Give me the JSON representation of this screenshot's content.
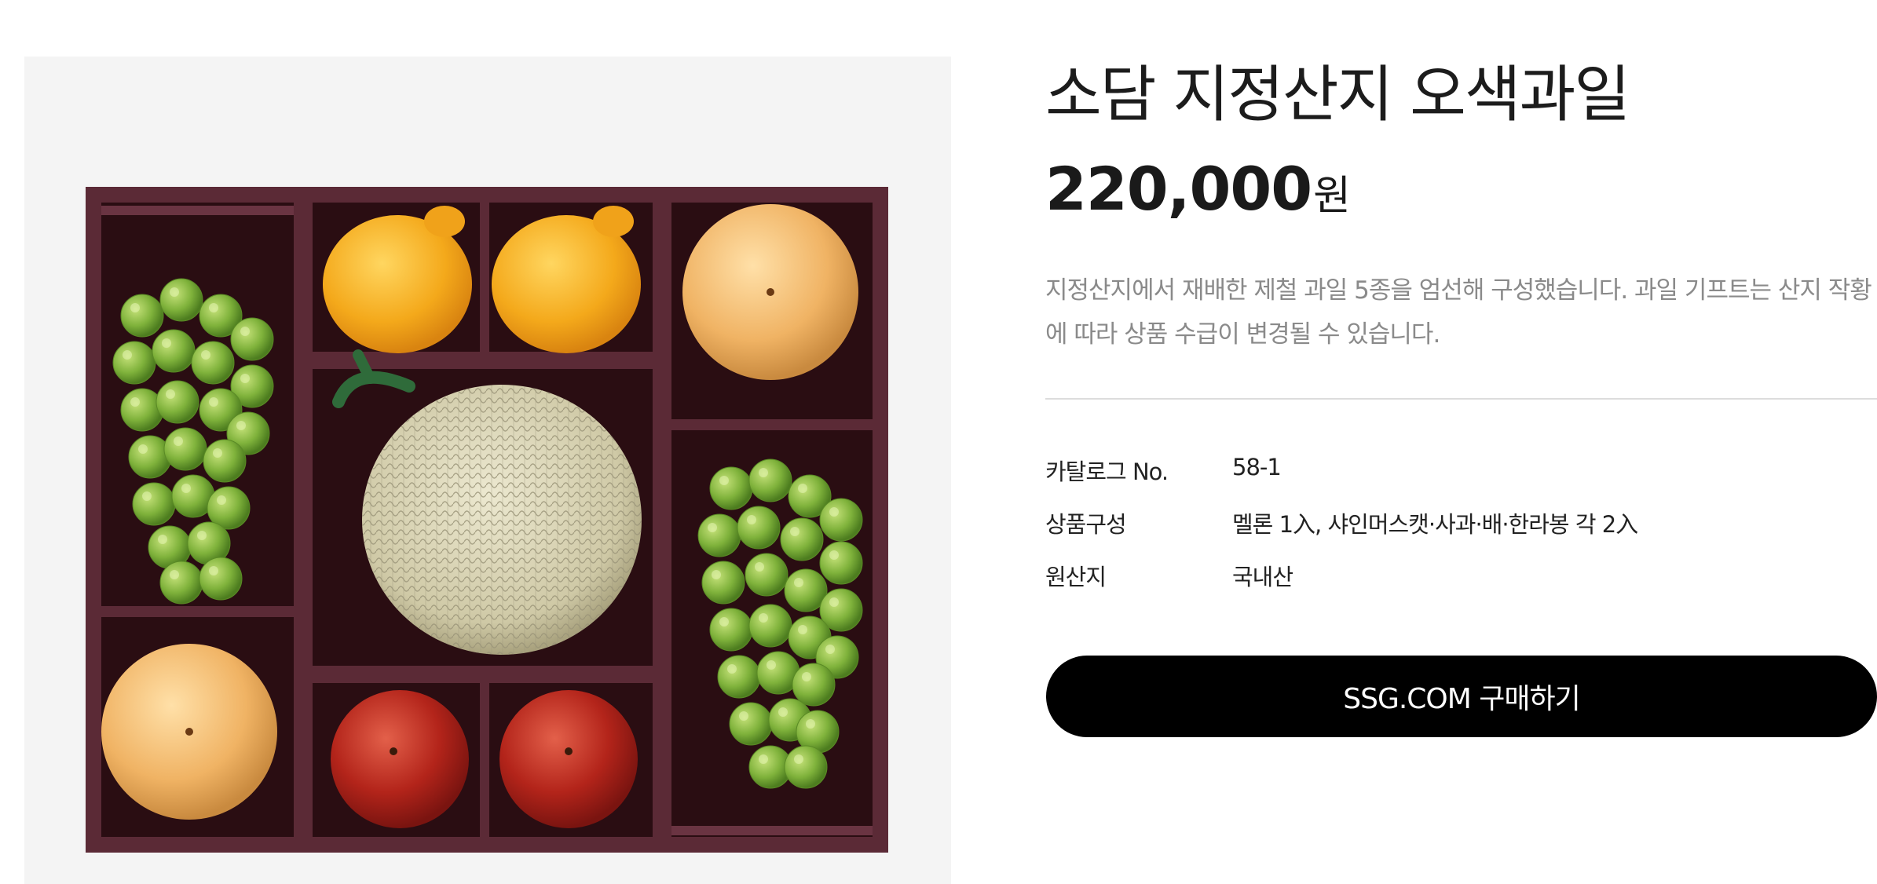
{
  "product": {
    "title": "소담 지정산지 오색과일",
    "price_value": "220,000",
    "price_unit": "원",
    "description": "지정산지에서 재배한 제철 과일 5종을 엄선해 구성했습니다. 과일 기프트는 산지 작황에 따라 상품 수급이 변경될 수 있습니다.",
    "image_icon": "fruit-gift-box-photo"
  },
  "specs": {
    "catalog": {
      "label": "카탈로그 No.",
      "value": "58-1"
    },
    "composition": {
      "label": "상품구성",
      "value": "멜론 1入, 샤인머스캣·사과·배·한라봉 각 2入"
    },
    "origin": {
      "label": "원산지",
      "value": "국내산"
    }
  },
  "actions": {
    "buy_label": "SSG.COM 구매하기"
  },
  "colors": {
    "button_bg": "#000000",
    "button_text": "#ffffff",
    "description_text": "#8a8a8a",
    "box_frame": "#5b2a36",
    "image_bg": "#f4f4f4"
  }
}
